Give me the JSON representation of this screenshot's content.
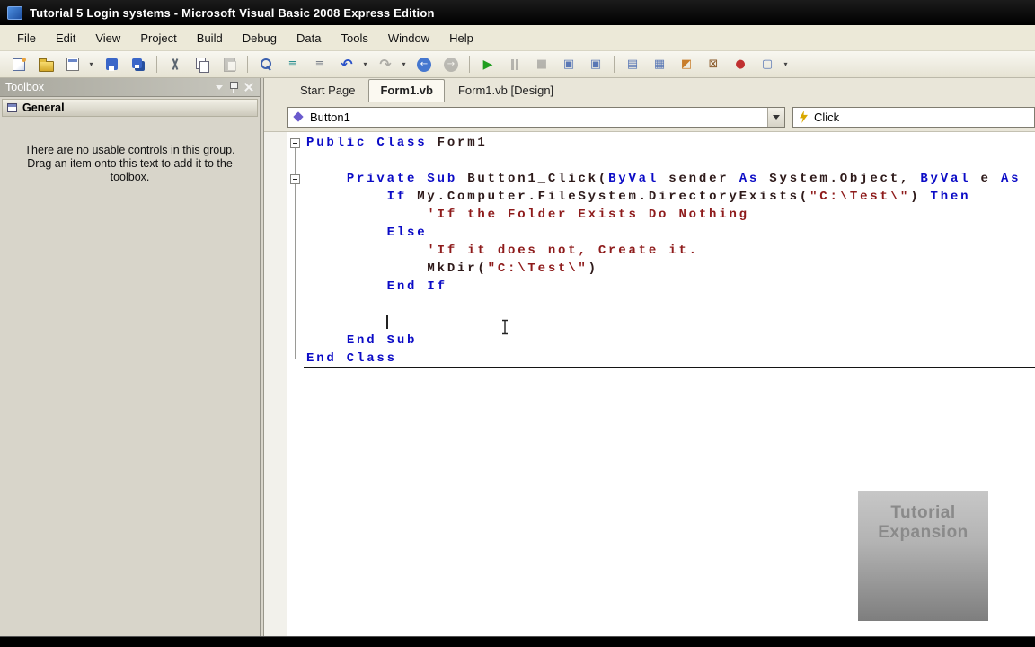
{
  "window": {
    "title": "Tutorial 5 Login systems - Microsoft Visual Basic 2008 Express Edition"
  },
  "menu": {
    "items": [
      "File",
      "Edit",
      "View",
      "Project",
      "Build",
      "Debug",
      "Data",
      "Tools",
      "Window",
      "Help"
    ]
  },
  "toolbar": {
    "items": [
      {
        "name": "new-project-icon",
        "cls": "i-newproj"
      },
      {
        "name": "open-file-icon",
        "cls": "i-folder"
      },
      {
        "name": "add-new-item-icon",
        "cls": "i-additem",
        "dropdown": true
      },
      {
        "name": "save-icon",
        "cls": "i-save"
      },
      {
        "name": "save-all-icon",
        "cls": "i-saveall"
      },
      {
        "sep": true
      },
      {
        "name": "cut-icon",
        "cls": "i-cut"
      },
      {
        "name": "copy-icon",
        "cls": "i-copy"
      },
      {
        "name": "paste-icon",
        "cls": "i-paste",
        "disabled": true
      },
      {
        "sep": true
      },
      {
        "name": "find-icon",
        "cls": "i-find"
      },
      {
        "name": "comment-icon",
        "glyph": "≡",
        "color": "#2a8f8f"
      },
      {
        "name": "uncomment-icon",
        "glyph": "≡",
        "color": "#7a8089"
      },
      {
        "name": "undo-icon",
        "glyph": "↶",
        "color": "#2a52c8",
        "cls": "i-arrow",
        "dropdown": true
      },
      {
        "name": "redo-icon",
        "glyph": "↷",
        "color": "#2a52c8",
        "cls": "i-arrow",
        "disabled": true,
        "dropdown": true
      },
      {
        "name": "navigate-backward-icon",
        "cls": "i-navb"
      },
      {
        "name": "navigate-forward-icon",
        "cls": "i-navf",
        "disabled": true
      },
      {
        "sep": true
      },
      {
        "name": "start-debugging-icon",
        "glyph": "▶",
        "color": "#1f9e1f",
        "cls": "i-play"
      },
      {
        "name": "break-all-icon",
        "cls": "i-pause",
        "disabled": true
      },
      {
        "name": "stop-debugging-icon",
        "glyph": "■",
        "color": "#666",
        "disabled": true
      },
      {
        "name": "step-into-icon",
        "glyph": "▣",
        "color": "#5a78b5"
      },
      {
        "name": "step-over-icon",
        "glyph": "▣",
        "color": "#5a78b5"
      },
      {
        "sep": true
      },
      {
        "name": "solution-explorer-icon",
        "glyph": "▤",
        "color": "#5a78b5"
      },
      {
        "name": "properties-window-icon",
        "glyph": "▦",
        "color": "#5a78b5"
      },
      {
        "name": "object-browser-icon",
        "glyph": "◩",
        "color": "#c87d2a"
      },
      {
        "name": "toolbox-icon",
        "glyph": "⊠",
        "color": "#8a5a2a"
      },
      {
        "name": "error-list-icon",
        "glyph": "●",
        "color": "#c03030"
      },
      {
        "name": "command-window-icon",
        "glyph": "▢",
        "color": "#5a78b5",
        "dropdown": true
      }
    ]
  },
  "toolbox": {
    "title": "Toolbox",
    "group": "General",
    "empty_message": "There are no usable controls in this group. Drag an item onto this text to add it to the toolbox."
  },
  "tabs": [
    {
      "label": "Start Page",
      "active": false
    },
    {
      "label": "Form1.vb",
      "active": true
    },
    {
      "label": "Form1.vb [Design]",
      "active": false
    }
  ],
  "combos": {
    "object": "Button1",
    "event": "Click"
  },
  "code": {
    "lines": [
      [
        [
          "kw",
          "Public Class"
        ],
        [
          "id",
          " Form1"
        ]
      ],
      [],
      [
        [
          "id",
          "    "
        ],
        [
          "kw",
          "Private Sub"
        ],
        [
          "id",
          " Button1_Click("
        ],
        [
          "kw",
          "ByVal"
        ],
        [
          "id",
          " sender "
        ],
        [
          "kw",
          "As"
        ],
        [
          "id",
          " System.Object, "
        ],
        [
          "kw",
          "ByVal"
        ],
        [
          "id",
          " e "
        ],
        [
          "kw",
          "As"
        ]
      ],
      [
        [
          "id",
          "        "
        ],
        [
          "kw",
          "If"
        ],
        [
          "id",
          " My.Computer.FileSystem.DirectoryExists("
        ],
        [
          "str",
          "\"C:\\Test\\\""
        ],
        [
          "id",
          ") "
        ],
        [
          "kw",
          "Then"
        ]
      ],
      [
        [
          "com",
          "            'If the Folder Exists Do Nothing"
        ]
      ],
      [
        [
          "id",
          "        "
        ],
        [
          "kw",
          "Else"
        ]
      ],
      [
        [
          "com",
          "            'If it does not, Create it."
        ]
      ],
      [
        [
          "id",
          "            MkDir("
        ],
        [
          "str",
          "\"C:\\Test\\\""
        ],
        [
          "id",
          ")"
        ]
      ],
      [
        [
          "id",
          "        "
        ],
        [
          "kw",
          "End If"
        ]
      ],
      [],
      [],
      [
        [
          "id",
          "    "
        ],
        [
          "kw",
          "End Sub"
        ]
      ],
      [
        [
          "kw",
          "End Class"
        ]
      ]
    ]
  },
  "watermark": {
    "line1": "Tutorial",
    "line2": "Expansion"
  },
  "colors": {
    "keyword": "#0b0bc6",
    "identifier": "#2e1a1a",
    "string": "#8e1b1b",
    "comment": "#8e1b1b",
    "titlebar_bg": "#000000",
    "chrome_bg": "#ECE9D8",
    "toolbox_bg": "#D8D5CA",
    "active_tab_bg": "#FBF9F1"
  }
}
